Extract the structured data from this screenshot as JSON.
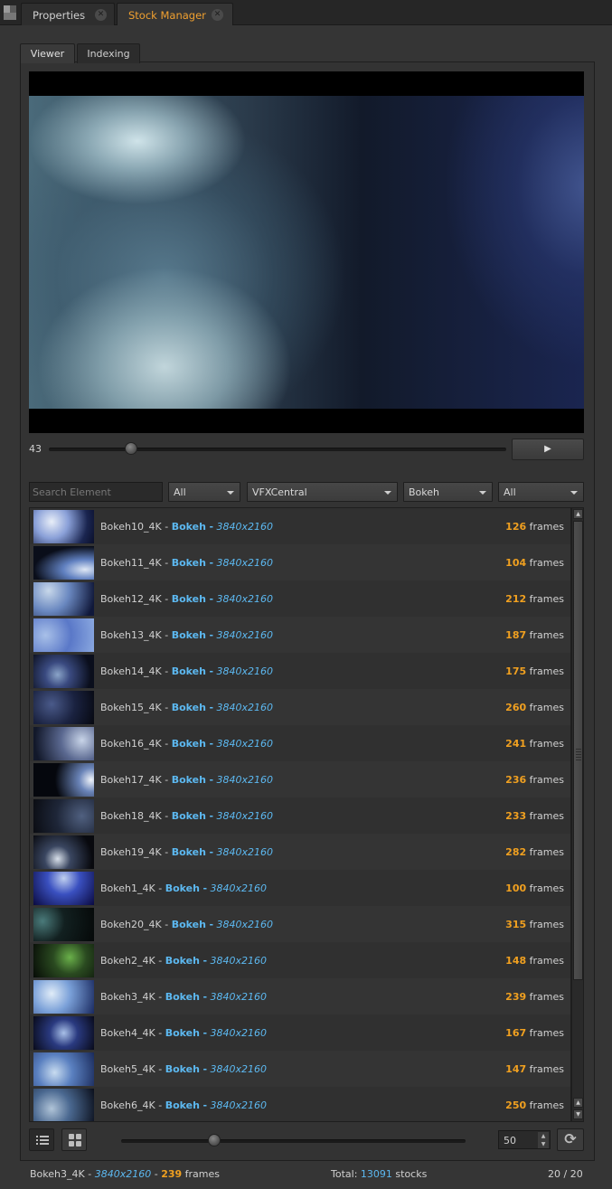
{
  "panel_tabs": [
    {
      "label": "Properties",
      "active": false
    },
    {
      "label": "Stock Manager",
      "active": true
    }
  ],
  "sub_tabs": [
    {
      "label": "Viewer",
      "active": true
    },
    {
      "label": "Indexing",
      "active": false
    }
  ],
  "viewer": {
    "frame": "43",
    "scrub_fraction": 0.18,
    "play_glyph": "▶"
  },
  "filters": {
    "search_placeholder": "Search Element",
    "type": "All",
    "source": "VFXCentral",
    "category": "Bokeh",
    "resolution": "All"
  },
  "colors": {
    "accent_orange": "#f0a020",
    "accent_blue": "#5cb8f0",
    "count_green": "#30d030"
  },
  "list": {
    "rows": [
      {
        "name": "Bokeh10_4K",
        "category": "Bokeh",
        "resolution": "3840x2160",
        "frames": "126"
      },
      {
        "name": "Bokeh11_4K",
        "category": "Bokeh",
        "resolution": "3840x2160",
        "frames": "104"
      },
      {
        "name": "Bokeh12_4K",
        "category": "Bokeh",
        "resolution": "3840x2160",
        "frames": "212"
      },
      {
        "name": "Bokeh13_4K",
        "category": "Bokeh",
        "resolution": "3840x2160",
        "frames": "187"
      },
      {
        "name": "Bokeh14_4K",
        "category": "Bokeh",
        "resolution": "3840x2160",
        "frames": "175"
      },
      {
        "name": "Bokeh15_4K",
        "category": "Bokeh",
        "resolution": "3840x2160",
        "frames": "260"
      },
      {
        "name": "Bokeh16_4K",
        "category": "Bokeh",
        "resolution": "3840x2160",
        "frames": "241"
      },
      {
        "name": "Bokeh17_4K",
        "category": "Bokeh",
        "resolution": "3840x2160",
        "frames": "236"
      },
      {
        "name": "Bokeh18_4K",
        "category": "Bokeh",
        "resolution": "3840x2160",
        "frames": "233"
      },
      {
        "name": "Bokeh19_4K",
        "category": "Bokeh",
        "resolution": "3840x2160",
        "frames": "282"
      },
      {
        "name": "Bokeh1_4K",
        "category": "Bokeh",
        "resolution": "3840x2160",
        "frames": "100"
      },
      {
        "name": "Bokeh20_4K",
        "category": "Bokeh",
        "resolution": "3840x2160",
        "frames": "315"
      },
      {
        "name": "Bokeh2_4K",
        "category": "Bokeh",
        "resolution": "3840x2160",
        "frames": "148"
      },
      {
        "name": "Bokeh3_4K",
        "category": "Bokeh",
        "resolution": "3840x2160",
        "frames": "239"
      },
      {
        "name": "Bokeh4_4K",
        "category": "Bokeh",
        "resolution": "3840x2160",
        "frames": "167"
      },
      {
        "name": "Bokeh5_4K",
        "category": "Bokeh",
        "resolution": "3840x2160",
        "frames": "147"
      },
      {
        "name": "Bokeh6_4K",
        "category": "Bokeh",
        "resolution": "3840x2160",
        "frames": "250"
      }
    ],
    "separator": "-",
    "frames_word": "frames"
  },
  "bottom": {
    "thumb_size": "50",
    "size_slider_fraction": 0.27,
    "list_view_icon": "list-view-icon",
    "grid_view_icon": "grid-view-icon",
    "refresh_icon": "refresh-icon"
  },
  "status": {
    "selected_name": "Bokeh3_4K",
    "selected_resolution": "3840x2160",
    "selected_frames": "239",
    "frames_word": "frames",
    "total_label": "Total:",
    "total_count": "13091",
    "total_suffix": "stocks",
    "shown_count": "20 / 20"
  }
}
